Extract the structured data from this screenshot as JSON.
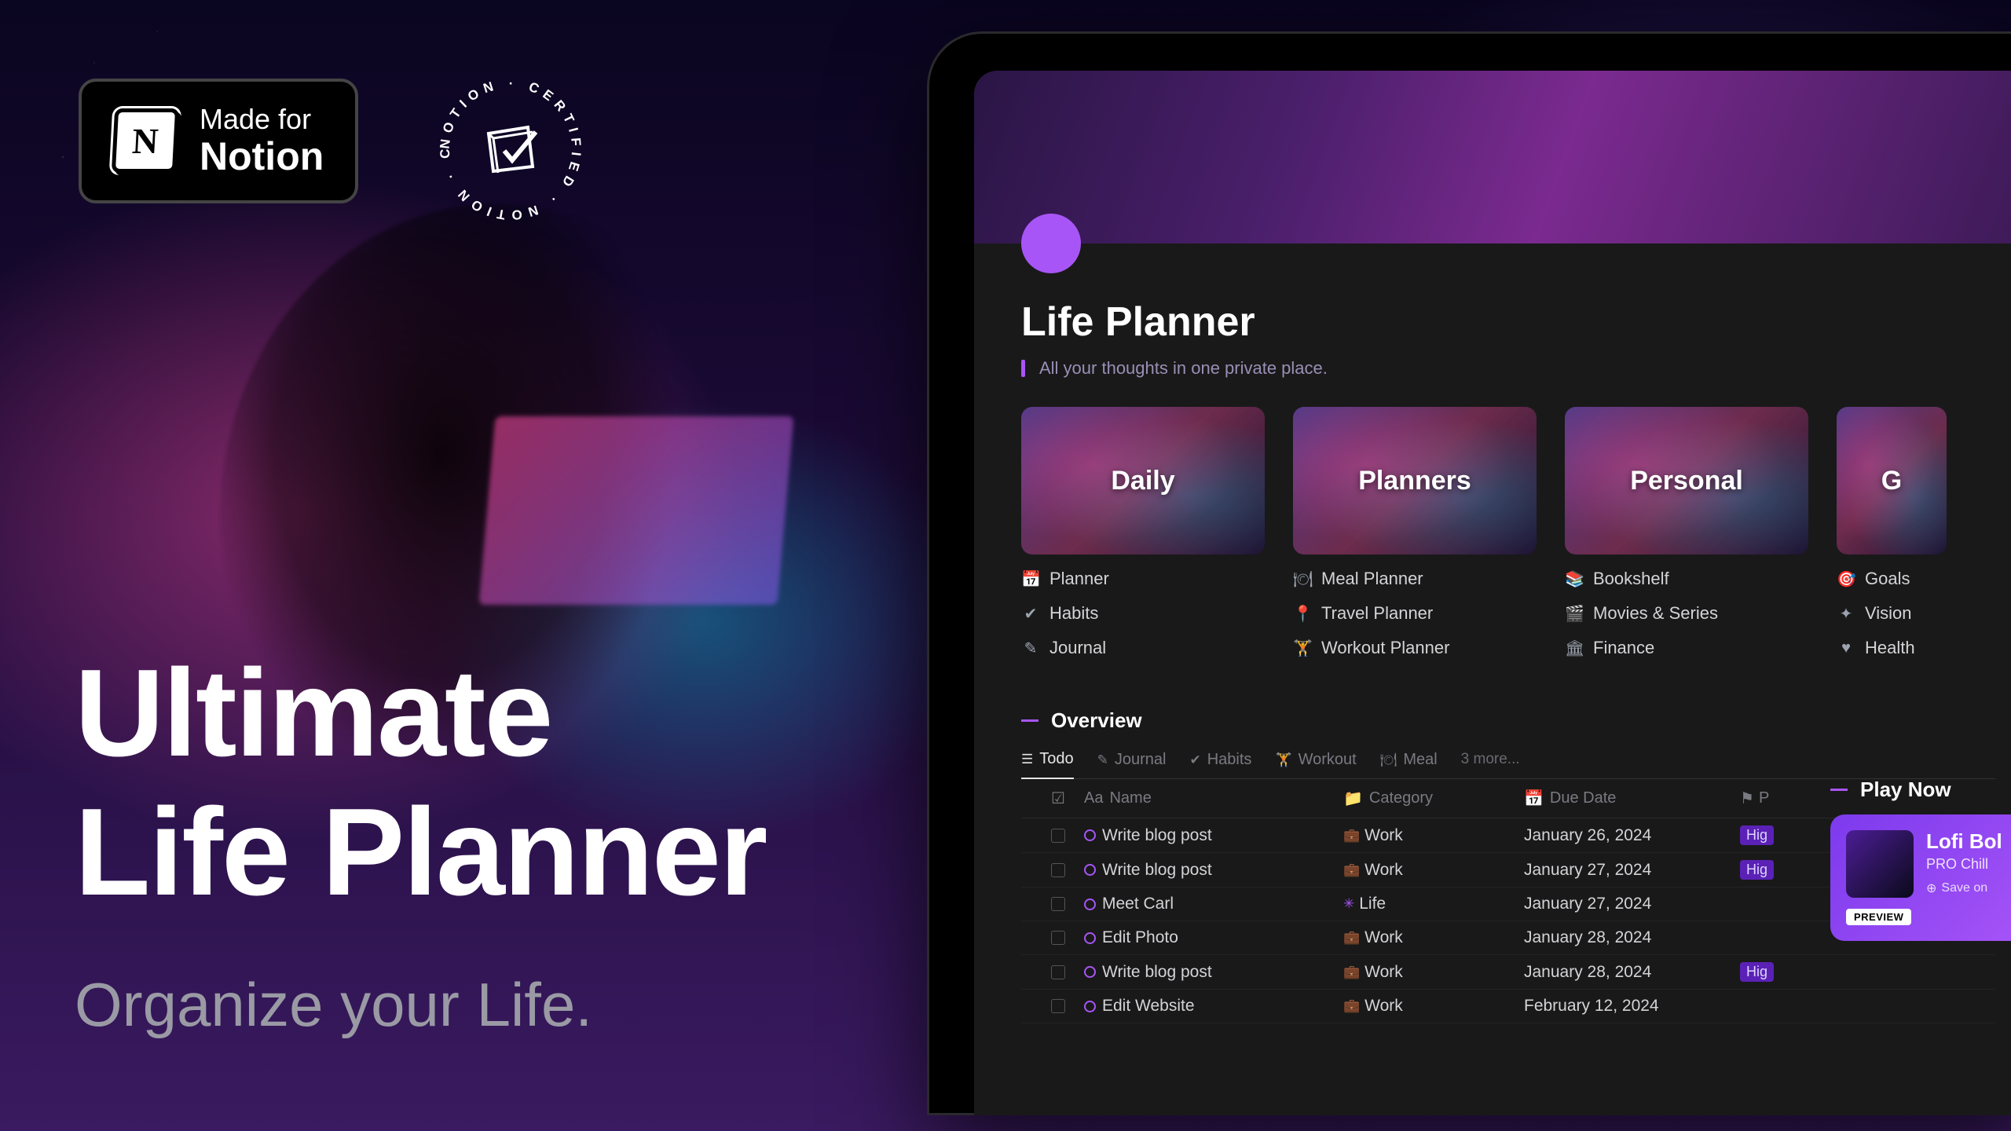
{
  "badge": {
    "line1": "Made for",
    "line2": "Notion",
    "logo_letter": "N"
  },
  "certified": {
    "text": "NOTION · CERTIFIED · NOTION · CERTIFIED · "
  },
  "hero": {
    "line1": "Ultimate",
    "line2": "Life Planner",
    "tagline": "Organize your Life."
  },
  "app": {
    "title": "Life Planner",
    "subtitle": "All your thoughts in one private place.",
    "sections": [
      {
        "heading": "Daily",
        "links": [
          {
            "icon": "📅",
            "label": "Planner"
          },
          {
            "icon": "✔",
            "label": "Habits"
          },
          {
            "icon": "✎",
            "label": "Journal"
          }
        ]
      },
      {
        "heading": "Planners",
        "links": [
          {
            "icon": "🍽",
            "label": "Meal Planner"
          },
          {
            "icon": "📍",
            "label": "Travel Planner"
          },
          {
            "icon": "🏋",
            "label": "Workout Planner"
          }
        ]
      },
      {
        "heading": "Personal",
        "links": [
          {
            "icon": "📚",
            "label": "Bookshelf"
          },
          {
            "icon": "🎬",
            "label": "Movies & Series"
          },
          {
            "icon": "🏛",
            "label": "Finance"
          }
        ]
      },
      {
        "heading": "G",
        "links": [
          {
            "icon": "🎯",
            "label": "Goals"
          },
          {
            "icon": "✦",
            "label": "Vision"
          },
          {
            "icon": "♥",
            "label": "Health"
          }
        ]
      }
    ]
  },
  "overview": {
    "heading": "Overview",
    "tabs": [
      {
        "icon": "☰",
        "label": "Todo",
        "active": true
      },
      {
        "icon": "✎",
        "label": "Journal"
      },
      {
        "icon": "✔",
        "label": "Habits"
      },
      {
        "icon": "🏋",
        "label": "Workout"
      },
      {
        "icon": "🍽",
        "label": "Meal"
      }
    ],
    "tabs_more": "3 more...",
    "columns": {
      "check": "",
      "name": "Name",
      "category": "Category",
      "due": "Due Date",
      "priority": "P"
    },
    "col_icons": {
      "name": "Aa",
      "category": "📁",
      "due": "📅",
      "priority": "⚑"
    },
    "rows": [
      {
        "name": "Write blog post",
        "category": "Work",
        "cat_icon": "💼",
        "due": "January 26, 2024",
        "priority": "Hig"
      },
      {
        "name": "Write blog post",
        "category": "Work",
        "cat_icon": "💼",
        "due": "January 27, 2024",
        "priority": "Hig"
      },
      {
        "name": "Meet Carl",
        "category": "Life",
        "cat_icon": "✳",
        "due": "January 27, 2024",
        "priority": ""
      },
      {
        "name": "Edit Photo",
        "category": "Work",
        "cat_icon": "💼",
        "due": "January 28, 2024",
        "priority": ""
      },
      {
        "name": "Write blog post",
        "category": "Work",
        "cat_icon": "💼",
        "due": "January 28, 2024",
        "priority": "Hig"
      },
      {
        "name": "Edit Website",
        "category": "Work",
        "cat_icon": "💼",
        "due": "February 12, 2024",
        "priority": ""
      }
    ]
  },
  "playnow": {
    "heading": "Play Now",
    "title": "Lofi Bol",
    "subtitle": "PRO Chill",
    "save": "Save on",
    "preview": "PREVIEW"
  }
}
